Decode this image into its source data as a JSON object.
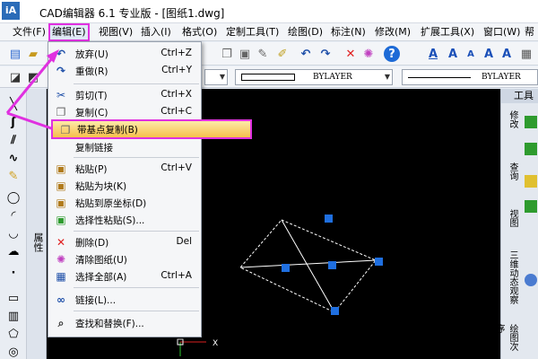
{
  "titlebar": {
    "app_icon": "iA",
    "title": "CAD编辑器 6.1 专业版  - [图纸1.dwg]"
  },
  "menubar": {
    "items": [
      "文件(F)",
      "编辑(E)",
      "视图(V)",
      "插入(I)",
      "格式(O)",
      "定制工具(T)",
      "绘图(D)",
      "标注(N)",
      "修改(M)",
      "扩展工具(X)",
      "窗口(W)",
      "帮"
    ]
  },
  "toolbar": {
    "bylayer_1": "BYLAYER",
    "bylayer_2": "BYLAYER"
  },
  "properties_panel": {
    "label": "属性"
  },
  "right_panel": {
    "title": "工具",
    "tabs": [
      "修改",
      "查询",
      "视图",
      "三维动态观察",
      "绘图次序"
    ]
  },
  "edit_menu": {
    "items": [
      {
        "label": "放弃(U)",
        "shortcut": "Ctrl+Z",
        "icon": "undo-icon"
      },
      {
        "label": "重做(R)",
        "shortcut": "Ctrl+Y",
        "icon": "redo-icon"
      },
      {
        "label": "剪切(T)",
        "shortcut": "Ctrl+X",
        "icon": "scissors-icon"
      },
      {
        "label": "复制(C)",
        "shortcut": "Ctrl+C",
        "icon": "copy-icon"
      },
      {
        "label": "带基点复制(B)",
        "shortcut": "",
        "icon": "copy-base-point-icon"
      },
      {
        "label": "复制链接",
        "shortcut": "",
        "icon": ""
      },
      {
        "label": "粘贴(P)",
        "shortcut": "Ctrl+V",
        "icon": "paste-icon"
      },
      {
        "label": "粘贴为块(K)",
        "shortcut": "",
        "icon": "paste-block-icon"
      },
      {
        "label": "粘贴到原坐标(D)",
        "shortcut": "",
        "icon": "paste-original-icon"
      },
      {
        "label": "选择性粘贴(S)...",
        "shortcut": "",
        "icon": "paste-special-icon"
      },
      {
        "label": "删除(D)",
        "shortcut": "Del",
        "icon": "delete-icon"
      },
      {
        "label": "清除图纸(U)",
        "shortcut": "",
        "icon": "clear-drawing-icon"
      },
      {
        "label": "选择全部(A)",
        "shortcut": "Ctrl+A",
        "icon": "select-all-icon"
      },
      {
        "label": "链接(L)...",
        "shortcut": "",
        "icon": "link-icon"
      },
      {
        "label": "查找和替换(F)...",
        "shortcut": "",
        "icon": "find-replace-icon"
      }
    ]
  },
  "canvas": {
    "ucs_x_label": "X"
  },
  "colors": {
    "highlight_border": "#e030e0",
    "grip": "#1f6fe0",
    "canvas_bg": "#000000"
  }
}
